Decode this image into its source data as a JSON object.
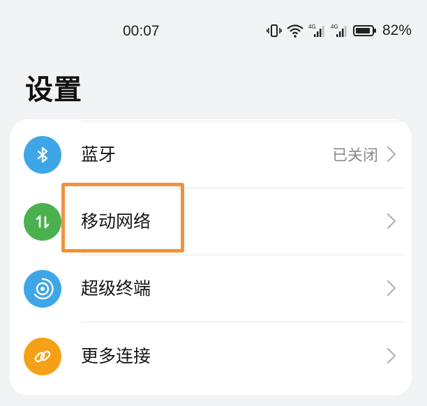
{
  "status_bar": {
    "time": "00:07",
    "signal1_label": "4G",
    "signal2_label": "4G",
    "battery_percent": "82%"
  },
  "page_title": "设置",
  "rows": [
    {
      "label": "蓝牙",
      "value": "已关闭",
      "icon": "bluetooth-icon",
      "color": "#3ea6e7"
    },
    {
      "label": "移动网络",
      "value": "",
      "icon": "mobile-data-icon",
      "color": "#4bb14e"
    },
    {
      "label": "超级终端",
      "value": "",
      "icon": "super-device-icon",
      "color": "#3ea6e7"
    },
    {
      "label": "更多连接",
      "value": "",
      "icon": "link-icon",
      "color": "#f5a117"
    }
  ],
  "highlight_color": "#f39239"
}
